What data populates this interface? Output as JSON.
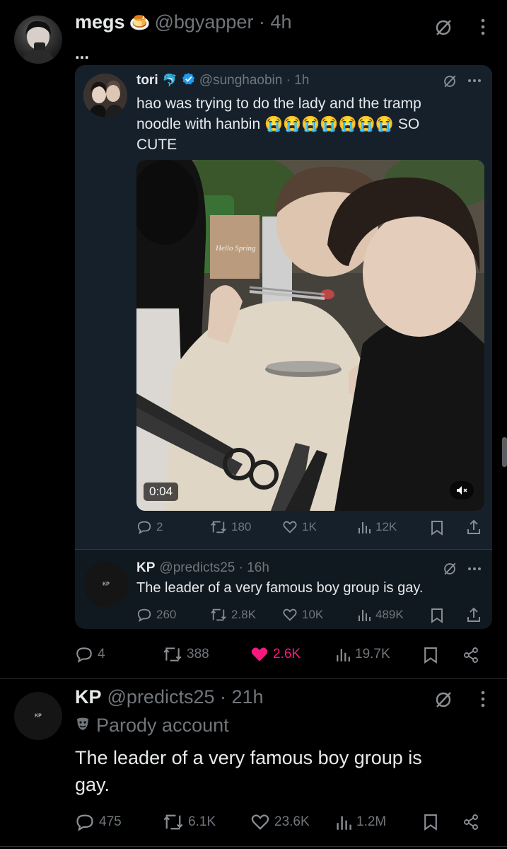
{
  "main_tweet": {
    "display_name": "megs",
    "name_emoji": "🍮",
    "handle_time": "@bgyapper · 4h",
    "body": "...",
    "actions": {
      "replies": "4",
      "reposts": "388",
      "likes": "2.6K",
      "views": "19.7K"
    },
    "colors": {
      "like": "#f91880"
    }
  },
  "quoted_tweet": {
    "display_name": "tori",
    "name_emoji": "🐬",
    "handle_time": "@sunghaobin · 1h",
    "text_line1": "hao was trying to do the lady and the tramp",
    "text_line2": "noodle with hanbin",
    "emojis": "😭😭😭😭😭😭😭",
    "text_suffix": "SO",
    "text_line3": "CUTE",
    "video_duration": "0:04",
    "media_sticker": "Hello Spring",
    "actions": {
      "replies": "2",
      "reposts": "180",
      "likes": "1K",
      "views": "12K"
    },
    "verified_color": "#1d9bf0"
  },
  "nested_tweet": {
    "display_name": "KP",
    "handle_time": "@predicts25 · 16h",
    "avatar_text": "KP",
    "text": "The leader of a very famous boy group is gay.",
    "actions": {
      "replies": "260",
      "reposts": "2.8K",
      "likes": "10K",
      "views": "489K"
    }
  },
  "second_tweet": {
    "display_name": "KP",
    "handle_time": "@predicts25 · 21h",
    "avatar_text": "KP",
    "label": "Parody account",
    "text_line1": "The leader of a very famous boy group is",
    "text_line2": "gay.",
    "actions": {
      "replies": "475",
      "reposts": "6.1K",
      "likes": "23.6K",
      "views": "1.2M"
    }
  }
}
